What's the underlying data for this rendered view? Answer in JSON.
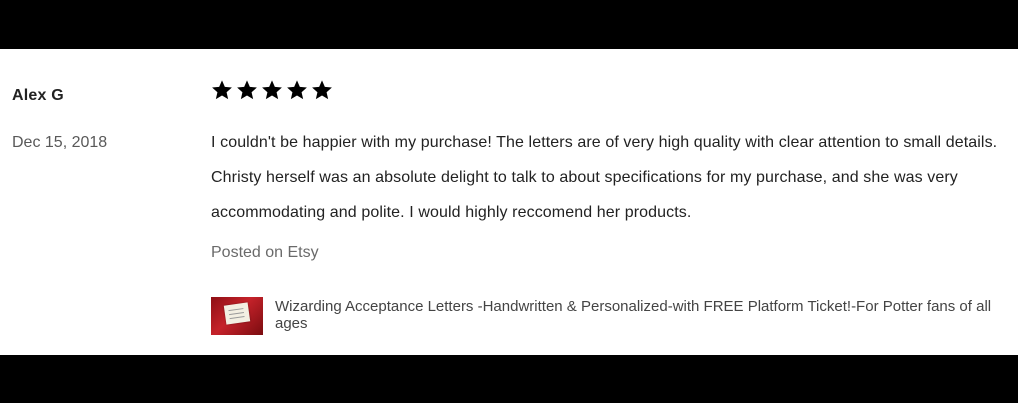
{
  "review": {
    "reviewer": "Alex G",
    "date": "Dec 15, 2018",
    "rating": 5,
    "rating_max": 5,
    "text": "I couldn't be happier with my purchase! The letters are of very high quality with clear attention to small details. Christy herself was an absolute delight to talk to about specifications for my purchase, and she was very accommodating and polite. I would highly reccomend her products.",
    "posted_on": "Posted on Etsy"
  },
  "product": {
    "title": "Wizarding Acceptance Letters -Handwritten & Personalized-with FREE Platform Ticket!-For Potter fans of all ages"
  },
  "icons": {
    "star": "star-icon"
  },
  "colors": {
    "star": "#000000",
    "frame": "#000000",
    "background": "#ffffff"
  }
}
